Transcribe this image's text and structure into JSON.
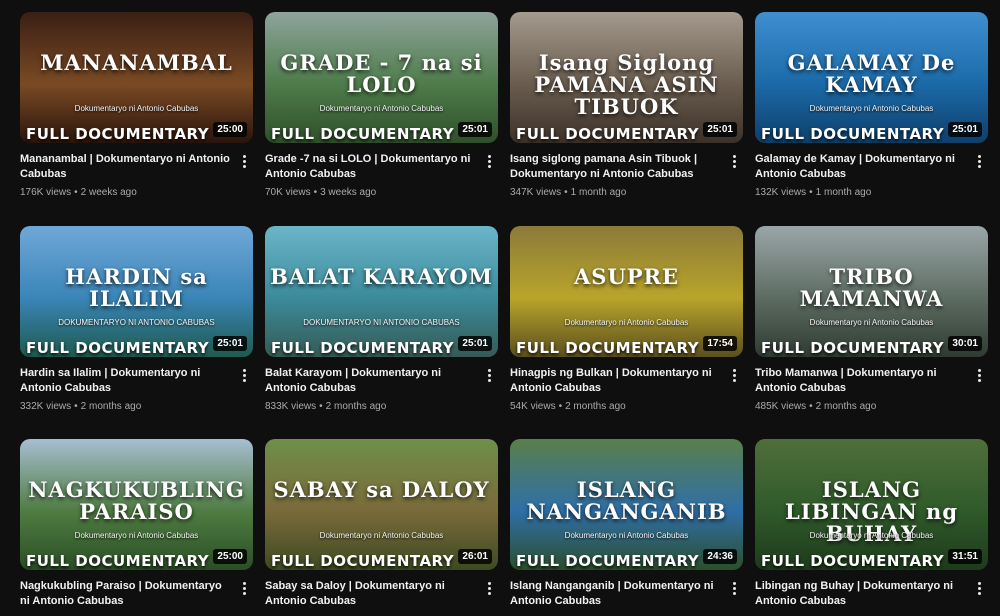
{
  "videos": [
    {
      "thumb_title": "MANANAMBAL",
      "thumb_sub": "Dokumentaryo ni Antonio Cabubas",
      "badge": "FULL DOCUMENTARY",
      "duration": "25:00",
      "title": "Mananambal | Dokumentaryo ni Antonio Cabubas",
      "views": "176K views",
      "age": "2 weeks ago",
      "colors": [
        "#3a1f14",
        "#7a4a24",
        "#2a140c"
      ]
    },
    {
      "thumb_title": "GRADE - 7 na si LOLO",
      "thumb_sub": "Dokumentaryo ni Antonio Cabubas",
      "badge": "FULL DOCUMENTARY",
      "duration": "25:01",
      "title": "Grade -7 na si LOLO | Dokumentaryo ni Antonio Cabubas",
      "views": "70K views",
      "age": "3 weeks ago",
      "colors": [
        "#8fa49c",
        "#4e7c4a",
        "#2f4f2b"
      ]
    },
    {
      "thumb_title": "Isang Siglong PAMANA ASIN TIBUOK",
      "thumb_sub": "",
      "badge": "FULL DOCUMENTARY",
      "duration": "25:01",
      "title": "Isang siglong pamana Asin Tibuok | Dokumentaryo ni Antonio Cabubas",
      "views": "347K views",
      "age": "1 month ago",
      "colors": [
        "#a49a8d",
        "#6a5d4f",
        "#3c3129"
      ]
    },
    {
      "thumb_title": "GALAMAY De KAMAY",
      "thumb_sub": "Dokumentaryo ni Antonio Cabubas",
      "badge": "FULL DOCUMENTARY",
      "duration": "25:01",
      "title": "Galamay de Kamay | Dokumentaryo ni Antonio Cabubas",
      "views": "132K views",
      "age": "1 month ago",
      "colors": [
        "#3f8fd1",
        "#1b6aa8",
        "#0e3f6a"
      ]
    },
    {
      "thumb_title": "HARDIN sa ILALIM",
      "thumb_sub": "DOKUMENTARYO NI ANTONIO CABUBAS",
      "badge": "FULL DOCUMENTARY",
      "duration": "25:01",
      "title": "Hardin sa Ilalim | Dokumentaryo ni Antonio Cabubas",
      "views": "332K views",
      "age": "2 months ago",
      "colors": [
        "#6fa8d8",
        "#3a85b7",
        "#1e5a4e"
      ]
    },
    {
      "thumb_title": "BALAT KARAYOM",
      "thumb_sub": "DOKUMENTARYO NI ANTONIO CABUBAS",
      "badge": "FULL DOCUMENTARY",
      "duration": "25:01",
      "title": "Balat Karayom | Dokumentaryo ni Antonio Cabubas",
      "views": "833K views",
      "age": "2 months ago",
      "colors": [
        "#6bb6c9",
        "#3b8b9b",
        "#355a55"
      ]
    },
    {
      "thumb_title": "ASUPRE",
      "thumb_sub": "Dokumentaryo ni Antonio Cabubas",
      "badge": "FULL DOCUMENTARY",
      "duration": "17:54",
      "title": "Hinagpis ng Bulkan | Dokumentaryo ni Antonio Cabubas",
      "views": "54K views",
      "age": "2 months ago",
      "colors": [
        "#8b7a3a",
        "#b9a52a",
        "#5b4f1e"
      ]
    },
    {
      "thumb_title": "TRIBO MAMANWA",
      "thumb_sub": "Dokumentaryo ni Antonio Cabubas",
      "badge": "FULL DOCUMENTARY",
      "duration": "30:01",
      "title": "Tribo Mamanwa | Dokumentaryo ni Antonio Cabubas",
      "views": "485K views",
      "age": "2 months ago",
      "colors": [
        "#9aa6a8",
        "#5d6c62",
        "#2f3b32"
      ]
    },
    {
      "thumb_title": "NAGKUKUBLING PARAISO",
      "thumb_sub": "Dokumentaryo ni Antonio Cabubas",
      "badge": "FULL DOCUMENTARY",
      "duration": "25:00",
      "title": "Nagkukubling Paraiso | Dokumentaryo ni Antonio Cabubas",
      "views": "",
      "age": "",
      "colors": [
        "#a7bed1",
        "#4f7d42",
        "#2a4d25"
      ]
    },
    {
      "thumb_title": "SABAY sa DALOY",
      "thumb_sub": "Dokumentaryo ni Antonio Cabubas",
      "badge": "FULL DOCUMENTARY",
      "duration": "26:01",
      "title": "Sabay sa Daloy | Dokumentaryo ni Antonio Cabubas",
      "views": "",
      "age": "",
      "colors": [
        "#6f8f4a",
        "#7a6a3a",
        "#3d4a22"
      ]
    },
    {
      "thumb_title": "ISLANG NANGANGANIB",
      "thumb_sub": "Dokumentaryo ni Antonio Cabubas",
      "badge": "FULL DOCUMENTARY",
      "duration": "24:36",
      "title": "Islang Nanganganib | Dokumentaryo ni Antonio Cabubas",
      "views": "",
      "age": "",
      "colors": [
        "#5a7f4a",
        "#2f6fa8",
        "#2c4e2a"
      ]
    },
    {
      "thumb_title": "ISLANG LIBINGAN ng BUHAY",
      "thumb_sub": "Dokumentaryo ni Antonio Cabubas",
      "badge": "FULL DOCUMENTARY",
      "duration": "31:51",
      "title": "Libingan ng Buhay | Dokumentaryo ni Antonio Cabubas",
      "views": "",
      "age": "",
      "colors": [
        "#4f6f3a",
        "#2f5a2a",
        "#1e3a1c"
      ]
    }
  ]
}
